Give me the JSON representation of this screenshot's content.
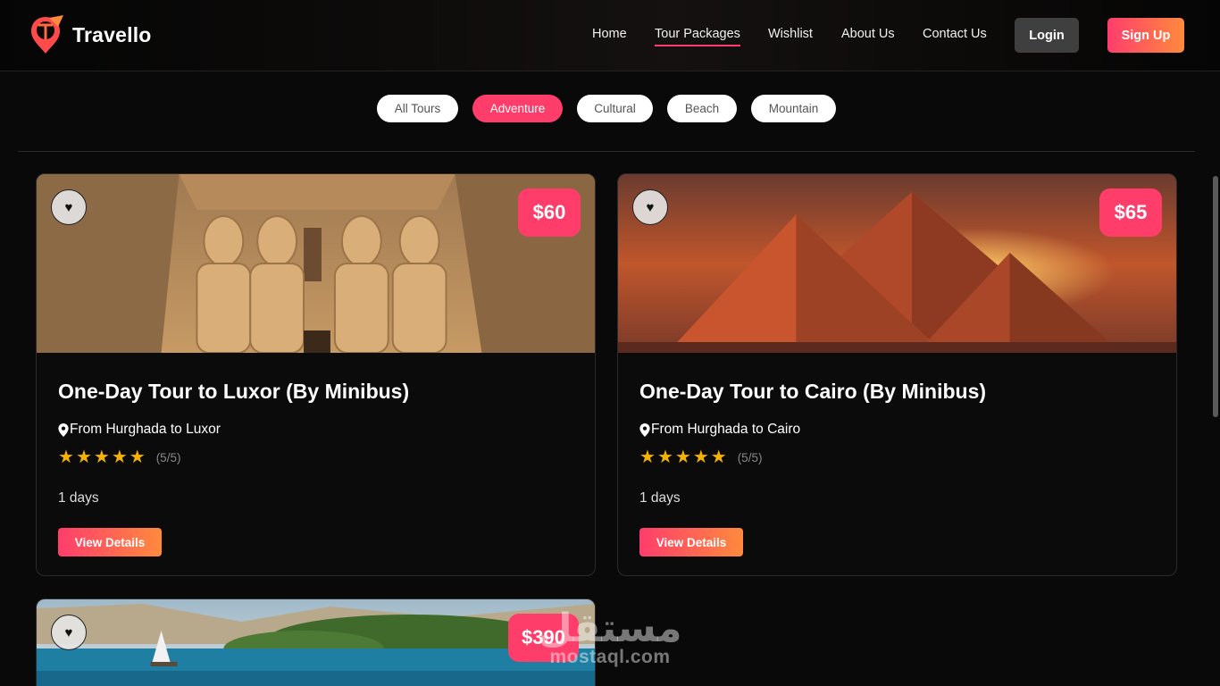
{
  "header": {
    "brand": "Travello",
    "nav": [
      "Home",
      "Tour Packages",
      "Wishlist",
      "About Us",
      "Contact Us"
    ],
    "active_nav": "Tour Packages",
    "login_label": "Login",
    "signup_label": "Sign Up"
  },
  "filters": {
    "items": [
      "All Tours",
      "Adventure",
      "Cultural",
      "Beach",
      "Mountain"
    ],
    "active": "Adventure"
  },
  "tours": [
    {
      "price": "$60",
      "title": "One-Day Tour to Luxor (By Minibus)",
      "route": "From Hurghada to Luxor",
      "rating": 5,
      "rating_text": "(5/5)",
      "duration": "1 days",
      "button": "View Details"
    },
    {
      "price": "$65",
      "title": "One-Day Tour to Cairo (By Minibus)",
      "route": "From Hurghada to Cairo",
      "rating": 5,
      "rating_text": "(5/5)",
      "duration": "1 days",
      "button": "View Details"
    },
    {
      "price": "$390"
    }
  ],
  "watermark": {
    "arabic": "مستقل",
    "latin": "mostaql.com"
  },
  "colors": {
    "accent": "#ff3d6a",
    "gradient_end": "#ff8a3d",
    "star": "#f5b301",
    "background": "#0a0909"
  },
  "icons": {
    "favorite": "heart-icon",
    "location": "map-pin-icon",
    "rating": "star-icon"
  }
}
